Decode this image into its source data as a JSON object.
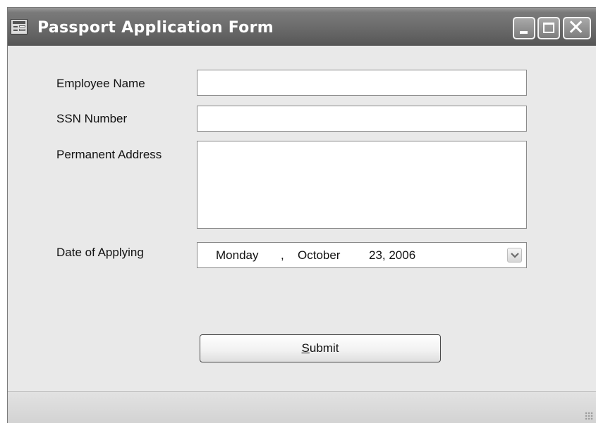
{
  "window": {
    "title": "Passport Application Form",
    "title_icon": "form-app-icon",
    "controls": [
      "minimize-icon",
      "maximize-icon",
      "close-icon"
    ],
    "close_glyph": "✕"
  },
  "form": {
    "employee_name": {
      "label": "Employee Name",
      "value": ""
    },
    "ssn_number": {
      "label": "SSN Number",
      "value": ""
    },
    "permanent_address": {
      "label": "Permanent Address",
      "value": ""
    },
    "date_of_applying": {
      "label": "Date of Applying",
      "weekday": "Monday",
      "separator": ",",
      "month": "October",
      "day_year": "23, 2006",
      "dropdown_icon": "chevron-down-icon"
    },
    "submit": {
      "mnemonic": "S",
      "rest": "ubmit"
    }
  },
  "status_bar": {
    "text": ""
  }
}
